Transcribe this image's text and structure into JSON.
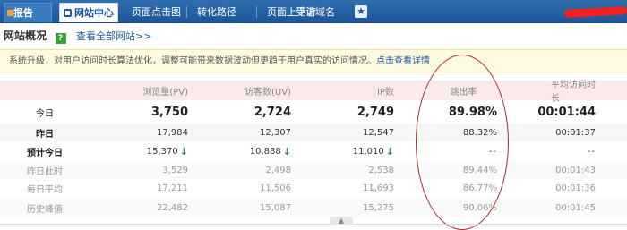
{
  "nav": {
    "report": "报告",
    "active": "网站中心",
    "tabs": [
      "页面点击图",
      "转化路径",
      "页面上下游",
      "受访域名"
    ]
  },
  "header": {
    "title": "网站概况",
    "help": "?",
    "all_sites": "查看全部网站>>"
  },
  "notice": {
    "text": "系统升级，对用户访问时长算法优化，调整可能带来数据波动但更趋于用户真实的访问情况。",
    "link": "点击查看详情"
  },
  "table": {
    "columns": [
      "",
      "浏览量(PV)",
      "访客数(UV)",
      "IP数",
      "跳出率",
      "平均访问时长"
    ],
    "rows": [
      {
        "label": "今日",
        "pv": "3,750",
        "uv": "2,724",
        "ip": "2,749",
        "bounce": "89.98%",
        "avg": "00:01:44"
      },
      {
        "label": "昨日",
        "pv": "17,984",
        "uv": "12,307",
        "ip": "12,547",
        "bounce": "88.32%",
        "avg": "00:01:37"
      },
      {
        "label": "预计今日",
        "pv": "15,370",
        "uv": "10,888",
        "ip": "11,010",
        "bounce": "--",
        "avg": "--"
      },
      {
        "label": "昨日此时",
        "pv": "3,529",
        "uv": "2,498",
        "ip": "2,538",
        "bounce": "89.44%",
        "avg": "00:01:43"
      },
      {
        "label": "每日平均",
        "pv": "17,211",
        "uv": "11,506",
        "ip": "11,693",
        "bounce": "86.77%",
        "avg": "00:01:36"
      },
      {
        "label": "历史峰值",
        "pv": "22,482",
        "uv": "15,087",
        "ip": "15,275",
        "bounce": "90.06%",
        "avg": "00:01:45"
      }
    ]
  },
  "colors": {
    "nav": "#1e5697",
    "header_row": "#fbeaea",
    "notice_bg": "#fffbe0",
    "down_arrow": "#2a8f3a",
    "annotation": "#b22a2a"
  },
  "icons": [
    "help-icon",
    "star-icon",
    "arrow-down-icon",
    "collapse-icon"
  ]
}
